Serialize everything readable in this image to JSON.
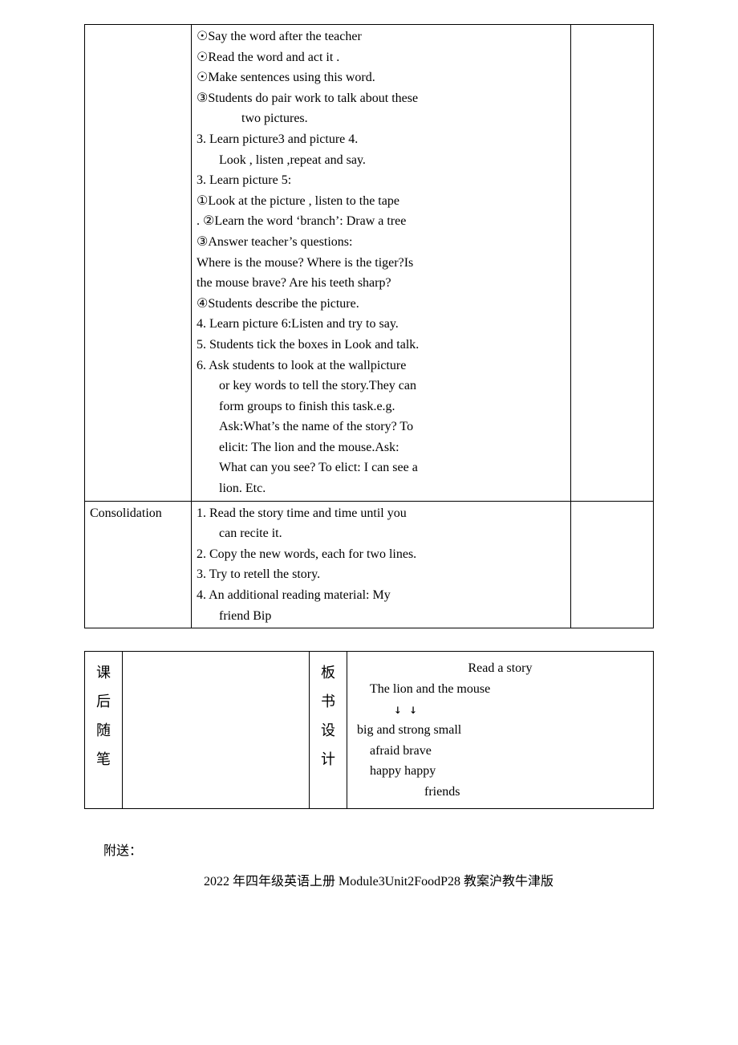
{
  "table1": {
    "row1": {
      "mid": {
        "l1": "☉Say the word after the teacher",
        "l2": "☉Read the word and act it .",
        "l3": "☉Make sentences using this word.",
        "l4": "③Students do pair work to talk about these",
        "l5": "two pictures.",
        "l6": "3. Learn picture3 and picture 4.",
        "l7": "Look , listen ,repeat and say.",
        "l8": "3.  Learn picture 5:",
        "l9": "①Look at the picture , listen to the tape",
        "l10": ". ②Learn the word ‘branch’: Draw a tree",
        "l11": "③Answer teacher’s questions:",
        "l12": "Where is the mouse? Where is  the tiger?Is",
        "l13": "the mouse brave? Are his teeth sharp?",
        "l14": "④Students describe the picture.",
        "l15": "4.  Learn picture 6:Listen and try to say.",
        "l16": "5.  Students tick the boxes in Look and talk.",
        "l17": "6.  Ask students to look at the wallpicture",
        "l18": "or key words to tell the story.They can",
        "l19": "form groups to finish this task.e.g.",
        "l20": "Ask:What’s the name of the story? To",
        "l21": "elicit: The lion  and the mouse.Ask:",
        "l22": "What can you see? To elict: I can see a",
        "l23": "lion. Etc."
      }
    },
    "row2": {
      "left": "Consolidation",
      "mid": {
        "l1": "1.  Read the story time and time until you",
        "l2": "can recite it.",
        "l3": "2.  Copy the new words, each for two lines.",
        "l4": "3.  Try to retell the story.",
        "l5": "4.  An  additional  reading  material:  My",
        "l6": "friend Bip"
      }
    }
  },
  "table2": {
    "leftLabel": {
      "c1": "课",
      "c2": "后",
      "c3": "随",
      "c4": "笔"
    },
    "midLabel": {
      "c1": "板",
      "c2": "书",
      "c3": "设",
      "c4": "计"
    },
    "right": {
      "l1": "Read a story",
      "l2": "The lion and the mouse",
      "l3": "↓          ↓",
      "l4": "big and strong   small",
      "l5": "afraid        brave",
      "l6": "happy        happy",
      "l7": "friends"
    }
  },
  "appendix": {
    "label": "附送：",
    "title": "2022 年四年级英语上册 Module3Unit2FoodP28 教案沪教牛津版"
  }
}
